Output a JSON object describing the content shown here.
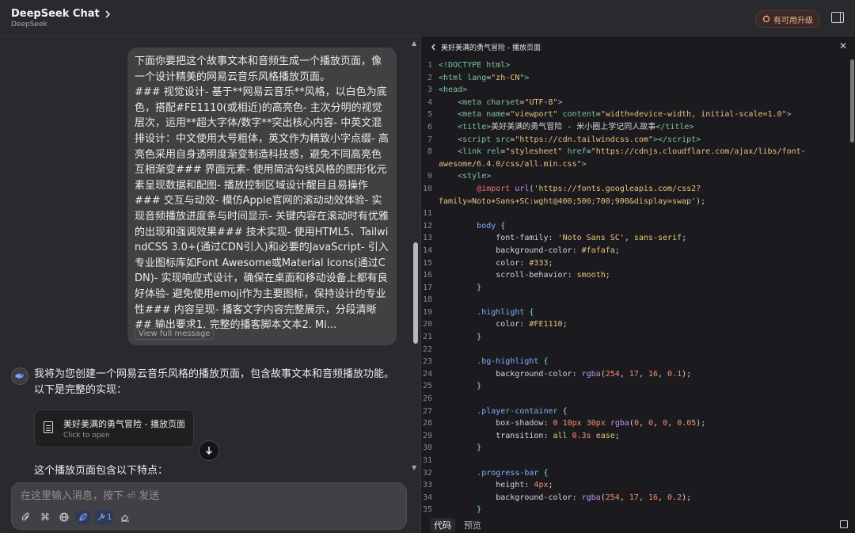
{
  "header": {
    "title": "DeepSeek Chat",
    "subtitle": "DeepSeek",
    "upgrade_label": "有可用升级"
  },
  "chat": {
    "user_message": "下面你要把这个故事文本和音频生成一个播放页面，像一个设计精美的网易云音乐风格播放页面。\n### 视觉设计- 基于**网易云音乐**风格，以白色为底色，搭配#FE1110(或相近)的高亮色- 主次分明的视觉层次，运用**超大字体/数字**突出核心内容- 中英文混排设计：中文使用大号粗体，英文作为精致小字点缀- 高亮色采用自身透明度渐变制造科技感，避免不同高亮色互相渐变### 界面元素- 使用简洁勾线风格的图形化元素呈现数据和配图- 播放控制区域设计醒目且易操作\n### 交互与动效- 模仿Apple官网的滚动动效体验- 实现音频播放进度条与时间显示- 关键内容在滚动时有优雅的出现和强调效果### 技术实现- 使用HTML5、TailwindCSS 3.0+(通过CDN引入)和必要的JavaScript- 引入专业图标库如Font Awesome或Material Icons(通过CDN)- 实现响应式设计，确保在桌面和移动设备上都有良好体验- 避免使用emoji作为主要图标，保持设计的专业性### 内容呈现- 播客文字内容完整展示，分段清晰\n## 输出要求1. 完整的播客脚本文本2. Mi...",
    "view_full_label": "View full message",
    "ai_intro": "我将为您创建一个网易云音乐风格的播放页面，包含故事文本和音频播放功能。以下是完整的实现：",
    "card_title": "美好美满的勇气冒险 - 播放页面",
    "card_sub": "Click to open",
    "features_heading": "这个播放页面包含以下特点：",
    "input_placeholder": "在这里输入消息，按下 ⏎ 发送",
    "tool_count": "1"
  },
  "code_panel": {
    "title": "美好美满的勇气冒险 - 播放页面",
    "tab_code": "代码",
    "tab_preview": "预览",
    "lines": [
      {
        "n": "1",
        "h": "<span class='t-tag'>&lt;!DOCTYPE html&gt;</span>"
      },
      {
        "n": "2",
        "h": "<span class='t-tag'>&lt;html</span> <span class='t-attr'>lang</span>=<span class='t-str'>\"zh-CN\"</span><span class='t-tag'>&gt;</span>"
      },
      {
        "n": "3",
        "h": "<span class='t-tag'>&lt;head&gt;</span>"
      },
      {
        "n": "4",
        "h": "    <span class='t-tag'>&lt;meta</span> <span class='t-attr'>charset</span>=<span class='t-str'>\"UTF-8\"</span><span class='t-tag'>&gt;</span>"
      },
      {
        "n": "5",
        "h": "    <span class='t-tag'>&lt;meta</span> <span class='t-attr'>name</span>=<span class='t-str'>\"viewport\"</span> <span class='t-attr'>content</span>=<span class='t-str'>\"width=device-width, initial-scale=1.0\"</span><span class='t-tag'>&gt;</span>"
      },
      {
        "n": "6",
        "h": "    <span class='t-tag'>&lt;title&gt;</span>美好美满的勇气冒险 - 米小圈上学记同人故事<span class='t-tag'>&lt;/title&gt;</span>"
      },
      {
        "n": "7",
        "h": "    <span class='t-tag'>&lt;script</span> <span class='t-attr'>src</span>=<span class='t-str'>\"https://cdn.tailwindcss.com\"</span><span class='t-tag'>&gt;&lt;/script&gt;</span>"
      },
      {
        "n": "8",
        "h": "    <span class='t-tag'>&lt;link</span> <span class='t-attr'>rel</span>=<span class='t-str'>\"stylesheet\"</span> <span class='t-attr'>href</span>=<span class='t-str'>\"https://cdnjs.cloudflare.com/ajax/libs/font-</span>"
      },
      {
        "n": "",
        "h": "<span class='t-str'>awesome/6.4.0/css/all.min.css\"</span><span class='t-tag'>&gt;</span>"
      },
      {
        "n": "9",
        "h": "    <span class='t-tag'>&lt;style&gt;</span>"
      },
      {
        "n": "10",
        "h": "        <span class='t-at'>@import</span> <span class='t-kw'>url</span>(<span class='t-str'>'https://fonts.googleapis.com/css2?</span>"
      },
      {
        "n": "",
        "h": "<span class='t-str'>family=Noto+Sans+SC:wght@400;500;700;900&amp;display=swap'</span>);"
      },
      {
        "n": "11",
        "h": ""
      },
      {
        "n": "12",
        "h": "        <span class='t-sel'>body</span> <span class='t-punc'>{</span>"
      },
      {
        "n": "13",
        "h": "            <span class='t-prop'>font-family</span>: <span class='t-val'>'Noto Sans SC'</span>, <span class='t-val'>sans-serif</span>;"
      },
      {
        "n": "14",
        "h": "            <span class='t-prop'>background-color</span>: <span class='t-val'>#fafafa</span>;"
      },
      {
        "n": "15",
        "h": "            <span class='t-prop'>color</span>: <span class='t-val'>#333</span>;"
      },
      {
        "n": "16",
        "h": "            <span class='t-prop'>scroll-behavior</span>: <span class='t-val'>smooth</span>;"
      },
      {
        "n": "17",
        "h": "        <span class='t-punc'>}</span>"
      },
      {
        "n": "18",
        "h": ""
      },
      {
        "n": "19",
        "h": "        <span class='t-sel'>.highlight</span> <span class='t-punc'>{</span>"
      },
      {
        "n": "20",
        "h": "            <span class='t-prop'>color</span>: <span class='t-val'>#FE1110</span>;"
      },
      {
        "n": "21",
        "h": "        <span class='t-punc'>}</span>"
      },
      {
        "n": "22",
        "h": ""
      },
      {
        "n": "23",
        "h": "        <span class='t-sel'>.bg-highlight</span> <span class='t-punc'>{</span>"
      },
      {
        "n": "24",
        "h": "            <span class='t-prop'>background-color</span>: <span class='t-kw'>rgba</span>(<span class='t-num'>254</span>, <span class='t-num'>17</span>, <span class='t-num'>16</span>, <span class='t-num'>0.1</span>);"
      },
      {
        "n": "25",
        "h": "        <span class='t-punc'>}</span>"
      },
      {
        "n": "26",
        "h": ""
      },
      {
        "n": "27",
        "h": "        <span class='t-sel'>.player-container</span> <span class='t-punc'>{</span>"
      },
      {
        "n": "28",
        "h": "            <span class='t-prop'>box-shadow</span>: <span class='t-num'>0</span> <span class='t-num'>10px</span> <span class='t-num'>30px</span> <span class='t-kw'>rgba</span>(<span class='t-num'>0</span>, <span class='t-num'>0</span>, <span class='t-num'>0</span>, <span class='t-num'>0.05</span>);"
      },
      {
        "n": "29",
        "h": "            <span class='t-prop'>transition</span>: <span class='t-val'>all</span> <span class='t-num'>0.3s</span> <span class='t-val'>ease</span>;"
      },
      {
        "n": "30",
        "h": "        <span class='t-punc'>}</span>"
      },
      {
        "n": "31",
        "h": ""
      },
      {
        "n": "32",
        "h": "        <span class='t-sel'>.progress-bar</span> <span class='t-punc'>{</span>"
      },
      {
        "n": "33",
        "h": "            <span class='t-prop'>height</span>: <span class='t-num'>4px</span>;"
      },
      {
        "n": "34",
        "h": "            <span class='t-prop'>background-color</span>: <span class='t-kw'>rgba</span>(<span class='t-num'>254</span>, <span class='t-num'>17</span>, <span class='t-num'>16</span>, <span class='t-num'>0.2</span>);"
      },
      {
        "n": "35",
        "h": "        <span class='t-punc'>}</span>"
      }
    ]
  }
}
